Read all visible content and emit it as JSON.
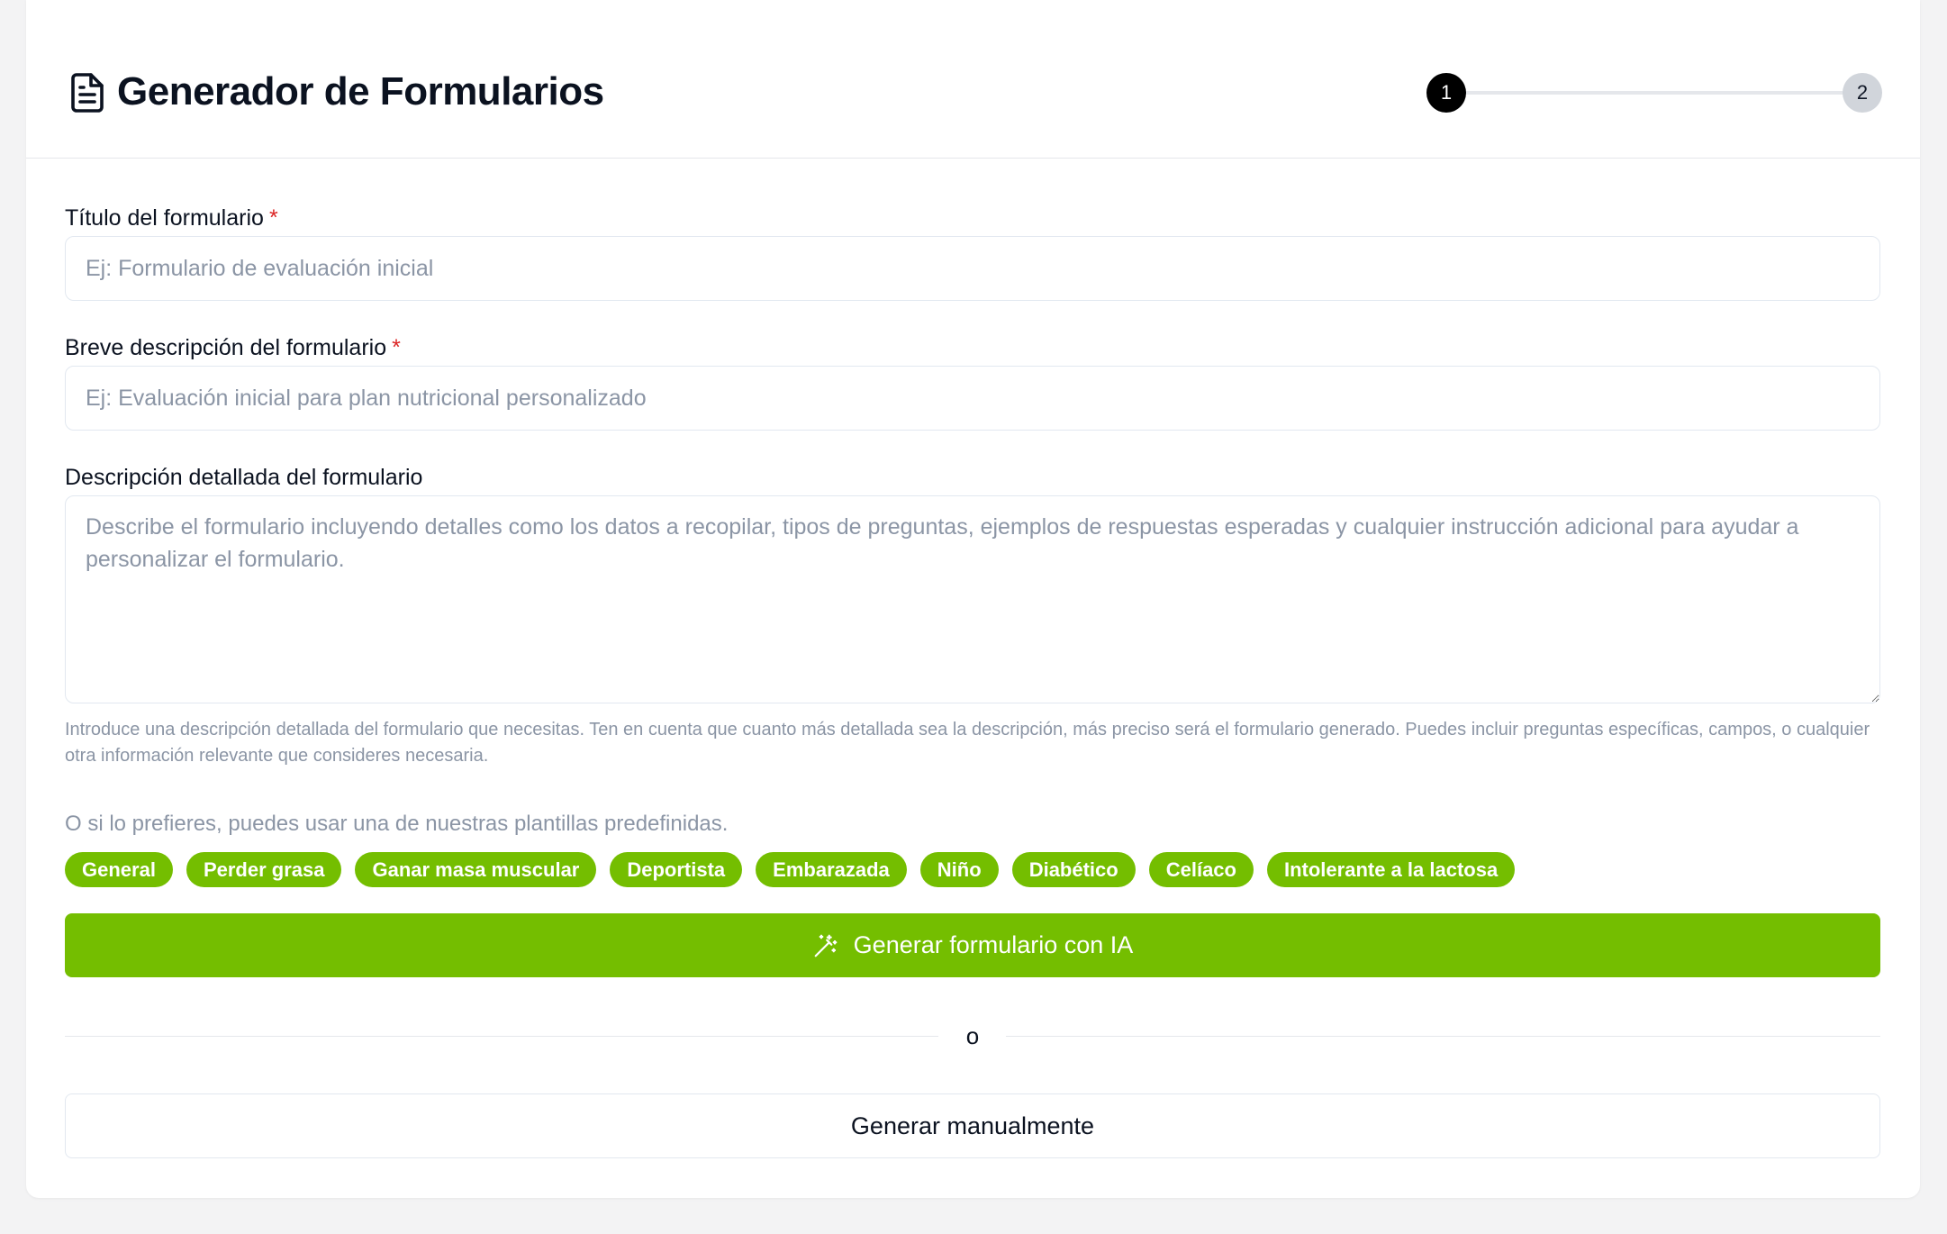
{
  "header": {
    "title": "Generador de Formularios",
    "icon": "document-icon",
    "steps": [
      "1",
      "2"
    ],
    "active_step": 1
  },
  "form": {
    "title_field": {
      "label": "Título del formulario",
      "required_mark": "*",
      "value": "",
      "placeholder": "Ej: Formulario de evaluación inicial"
    },
    "short_description_field": {
      "label": "Breve descripción del formulario",
      "required_mark": "*",
      "value": "",
      "placeholder": "Ej: Evaluación inicial para plan nutricional personalizado"
    },
    "detailed_description_field": {
      "label": "Descripción detallada del formulario",
      "value": "",
      "placeholder": "Describe el formulario incluyendo detalles como los datos a recopilar, tipos de preguntas, ejemplos de respuestas esperadas y cualquier instrucción adicional para ayudar a personalizar el formulario.",
      "hint": "Introduce una descripción detallada del formulario que necesitas. Ten en cuenta que cuanto más detallada sea la descripción, más preciso será el formulario generado. Puedes incluir preguntas específicas, campos, o cualquier otra información relevante que consideres necesaria."
    }
  },
  "templates": {
    "intro": "O si lo prefieres, puedes usar una de nuestras plantillas predefinidas.",
    "items": [
      "General",
      "Perder grasa",
      "Ganar masa muscular",
      "Deportista",
      "Embarazada",
      "Niño",
      "Diabético",
      "Celíaco",
      "Intolerante a la lactosa"
    ]
  },
  "actions": {
    "ai_button_label": "Generar formulario con IA",
    "ai_button_icon": "magic-wand-icon",
    "divider_text": "o",
    "manual_button_label": "Generar manualmente"
  },
  "colors": {
    "accent": "#74be00",
    "required": "#dc2626",
    "active_step": "#000000",
    "inactive_step": "#d1d5db"
  }
}
